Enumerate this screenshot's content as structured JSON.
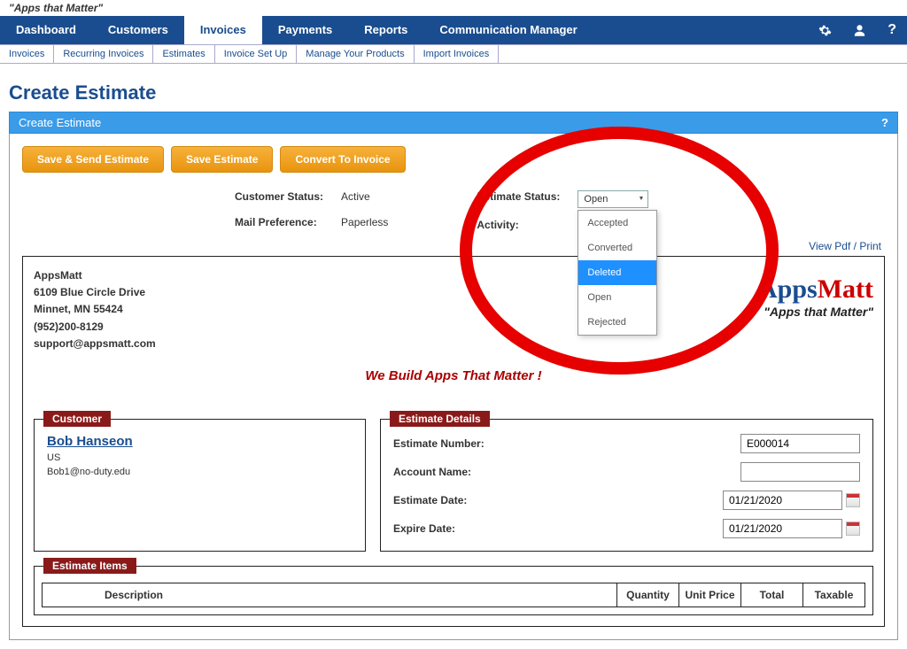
{
  "topTagline": "\"Apps that Matter\"",
  "mainNav": {
    "dashboard": "Dashboard",
    "customers": "Customers",
    "invoices": "Invoices",
    "payments": "Payments",
    "reports": "Reports",
    "comm": "Communication Manager"
  },
  "subNav": {
    "invoices": "Invoices",
    "recurring": "Recurring Invoices",
    "estimates": "Estimates",
    "setup": "Invoice Set Up",
    "products": "Manage Your Products",
    "import": "Import Invoices"
  },
  "pageTitle": "Create Estimate",
  "panelTitle": "Create Estimate",
  "buttons": {
    "saveSend": "Save & Send Estimate",
    "save": "Save Estimate",
    "convert": "Convert To Invoice"
  },
  "statusLeft": {
    "custStatusLbl": "Customer Status:",
    "custStatusVal": "Active",
    "mailPrefLbl": "Mail Preference:",
    "mailPrefVal": "Paperless"
  },
  "statusRight": {
    "estStatusLbl": "Estimate Status:",
    "activityLbl": "Activity:",
    "selected": "Open",
    "options": {
      "accepted": "Accepted",
      "converted": "Converted",
      "deleted": "Deleted",
      "open": "Open",
      "rejected": "Rejected"
    }
  },
  "viewPrint": "View Pdf / Print",
  "company": {
    "name": "AppsMatt",
    "addr1": "6109 Blue Circle Drive",
    "addr2": "Minnet, MN 55424",
    "phone": "(952)200-8129",
    "email": "support@appsmatt.com",
    "logoApps": "Apps",
    "logoMatt": "Matt",
    "logoTag": "\"Apps that Matter\"",
    "slogan": "We Build Apps That Matter !"
  },
  "customerBox": {
    "legend": "Customer",
    "name": "Bob Hanseon",
    "country": "US",
    "email": "Bob1@no-duty.edu"
  },
  "detailsBox": {
    "legend": "Estimate Details",
    "estNumLbl": "Estimate Number:",
    "estNumVal": "E000014",
    "acctLbl": "Account Name:",
    "acctVal": "",
    "estDateLbl": "Estimate Date:",
    "estDateVal": "01/21/2020",
    "expDateLbl": "Expire Date:",
    "expDateVal": "01/21/2020"
  },
  "items": {
    "legend": "Estimate Items",
    "cols": {
      "desc": "Description",
      "qty": "Quantity",
      "unit": "Unit Price",
      "total": "Total",
      "tax": "Taxable"
    }
  },
  "helpMark": "?"
}
